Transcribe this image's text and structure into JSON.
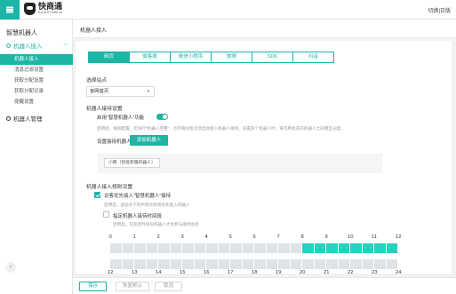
{
  "topbar": {
    "logo_name": "快商通",
    "logo_sub": "KUAISTOMI AI",
    "lang_switch": "切换|日版"
  },
  "sidebar": {
    "title": "智慧机器人",
    "group1": "机器人接入",
    "items": [
      "机器人接入",
      "消息过滤设置",
      "获取分配设置",
      "获取分配记录",
      "提醒设置"
    ],
    "group2": "机器人管理"
  },
  "breadcrumb": "机器人接入",
  "tabs": [
    "网页",
    "微客服",
    "微信小程序",
    "微博",
    "SDK",
    "抖音"
  ],
  "site": {
    "label": "选择站点",
    "value": "官网首页"
  },
  "access": {
    "title": "机器人接待设置",
    "enable_label": "启用“智慧机器人”功能",
    "enabled": true,
    "enable_hint": "启用后，根据配置，可进行“机器人完整”，也可将访客对话自动接入机器人接待。设置多个机器人时，将可用状态的机器人之间相互分配。",
    "set_label": "设置接待机器人",
    "add_button": "添加机器人",
    "robot_tag": "小薇（智能客服机器人）"
  },
  "rules": {
    "title": "机器人接入规则设置",
    "priority_label": "访客优先接入“智慧机器人”接待",
    "priority_checked": true,
    "priority_hint": "启用后，该站点下的所有访客将优先接入机器人",
    "period_label": "指定机器人接待时间段",
    "period_checked": false,
    "period_hint": "启用后，在指定时间段机器人才会参与接待会话",
    "hours_row1": [
      "0",
      "1",
      "2",
      "3",
      "4",
      "5",
      "6",
      "7",
      "8",
      "9",
      "10",
      "11",
      "12"
    ],
    "hours_row2": [
      "12",
      "13",
      "14",
      "15",
      "16",
      "17",
      "18",
      "19",
      "20",
      "21",
      "22",
      "23",
      "24"
    ],
    "row1_on": [
      0,
      0,
      0,
      0,
      0,
      0,
      0,
      0,
      0,
      0,
      0,
      0,
      0,
      0,
      0,
      0,
      1,
      1,
      1,
      1,
      1,
      1,
      1,
      1
    ],
    "row2_on": [
      0,
      0,
      0,
      0,
      0,
      0,
      0,
      0,
      0,
      0,
      0,
      0,
      0,
      0,
      0,
      0,
      0,
      0,
      0,
      0,
      0,
      0,
      0,
      0
    ]
  },
  "footer": {
    "save": "保存",
    "restore": "恢复默认",
    "cancel": "取消"
  },
  "colors": {
    "accent": "#1cb5a6",
    "cell_on": "#27d1c0",
    "cell_off": "#dfe3e6"
  }
}
